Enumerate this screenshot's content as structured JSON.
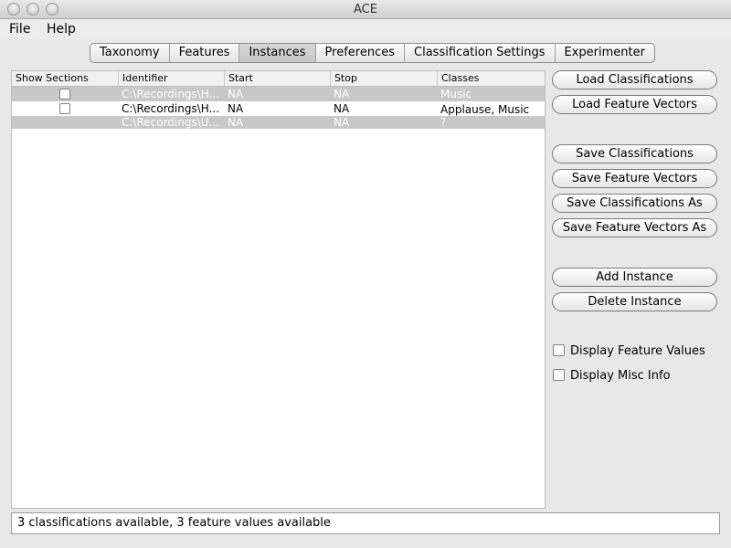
{
  "window": {
    "title": "ACE"
  },
  "menu": {
    "file": "File",
    "help": "Help"
  },
  "tabs": [
    {
      "label": "Taxonomy"
    },
    {
      "label": "Features"
    },
    {
      "label": "Instances"
    },
    {
      "label": "Preferences"
    },
    {
      "label": "Classification Settings"
    },
    {
      "label": "Experimenter"
    }
  ],
  "active_tab": "Instances",
  "table": {
    "columns": [
      "Show Sections",
      "Identifier",
      "Start",
      "Stop",
      "Classes"
    ],
    "rows": [
      {
        "identifier": "C:\\Recordings\\H...",
        "start": "NA",
        "stop": "NA",
        "classes": "Music",
        "selected": true,
        "has_checkbox": true
      },
      {
        "identifier": "C:\\Recordings\\H...",
        "start": "NA",
        "stop": "NA",
        "classes": "Applause, Music",
        "selected": false,
        "has_checkbox": true
      },
      {
        "identifier": "C:\\Recordings\\U...",
        "start": "NA",
        "stop": "NA",
        "classes": "?",
        "selected": true,
        "has_checkbox": false
      }
    ]
  },
  "buttons": {
    "load_classifications": "Load Classifications",
    "load_feature_vectors": "Load Feature Vectors",
    "save_classifications": "Save Classifications",
    "save_feature_vectors": "Save Feature Vectors",
    "save_classifications_as": "Save Classifications As",
    "save_feature_vectors_as": "Save Feature Vectors As",
    "add_instance": "Add Instance",
    "delete_instance": "Delete Instance"
  },
  "checkboxes": {
    "display_feature_values": "Display Feature Values",
    "display_misc_info": "Display Misc Info"
  },
  "status": "3 classifications available, 3 feature values available"
}
